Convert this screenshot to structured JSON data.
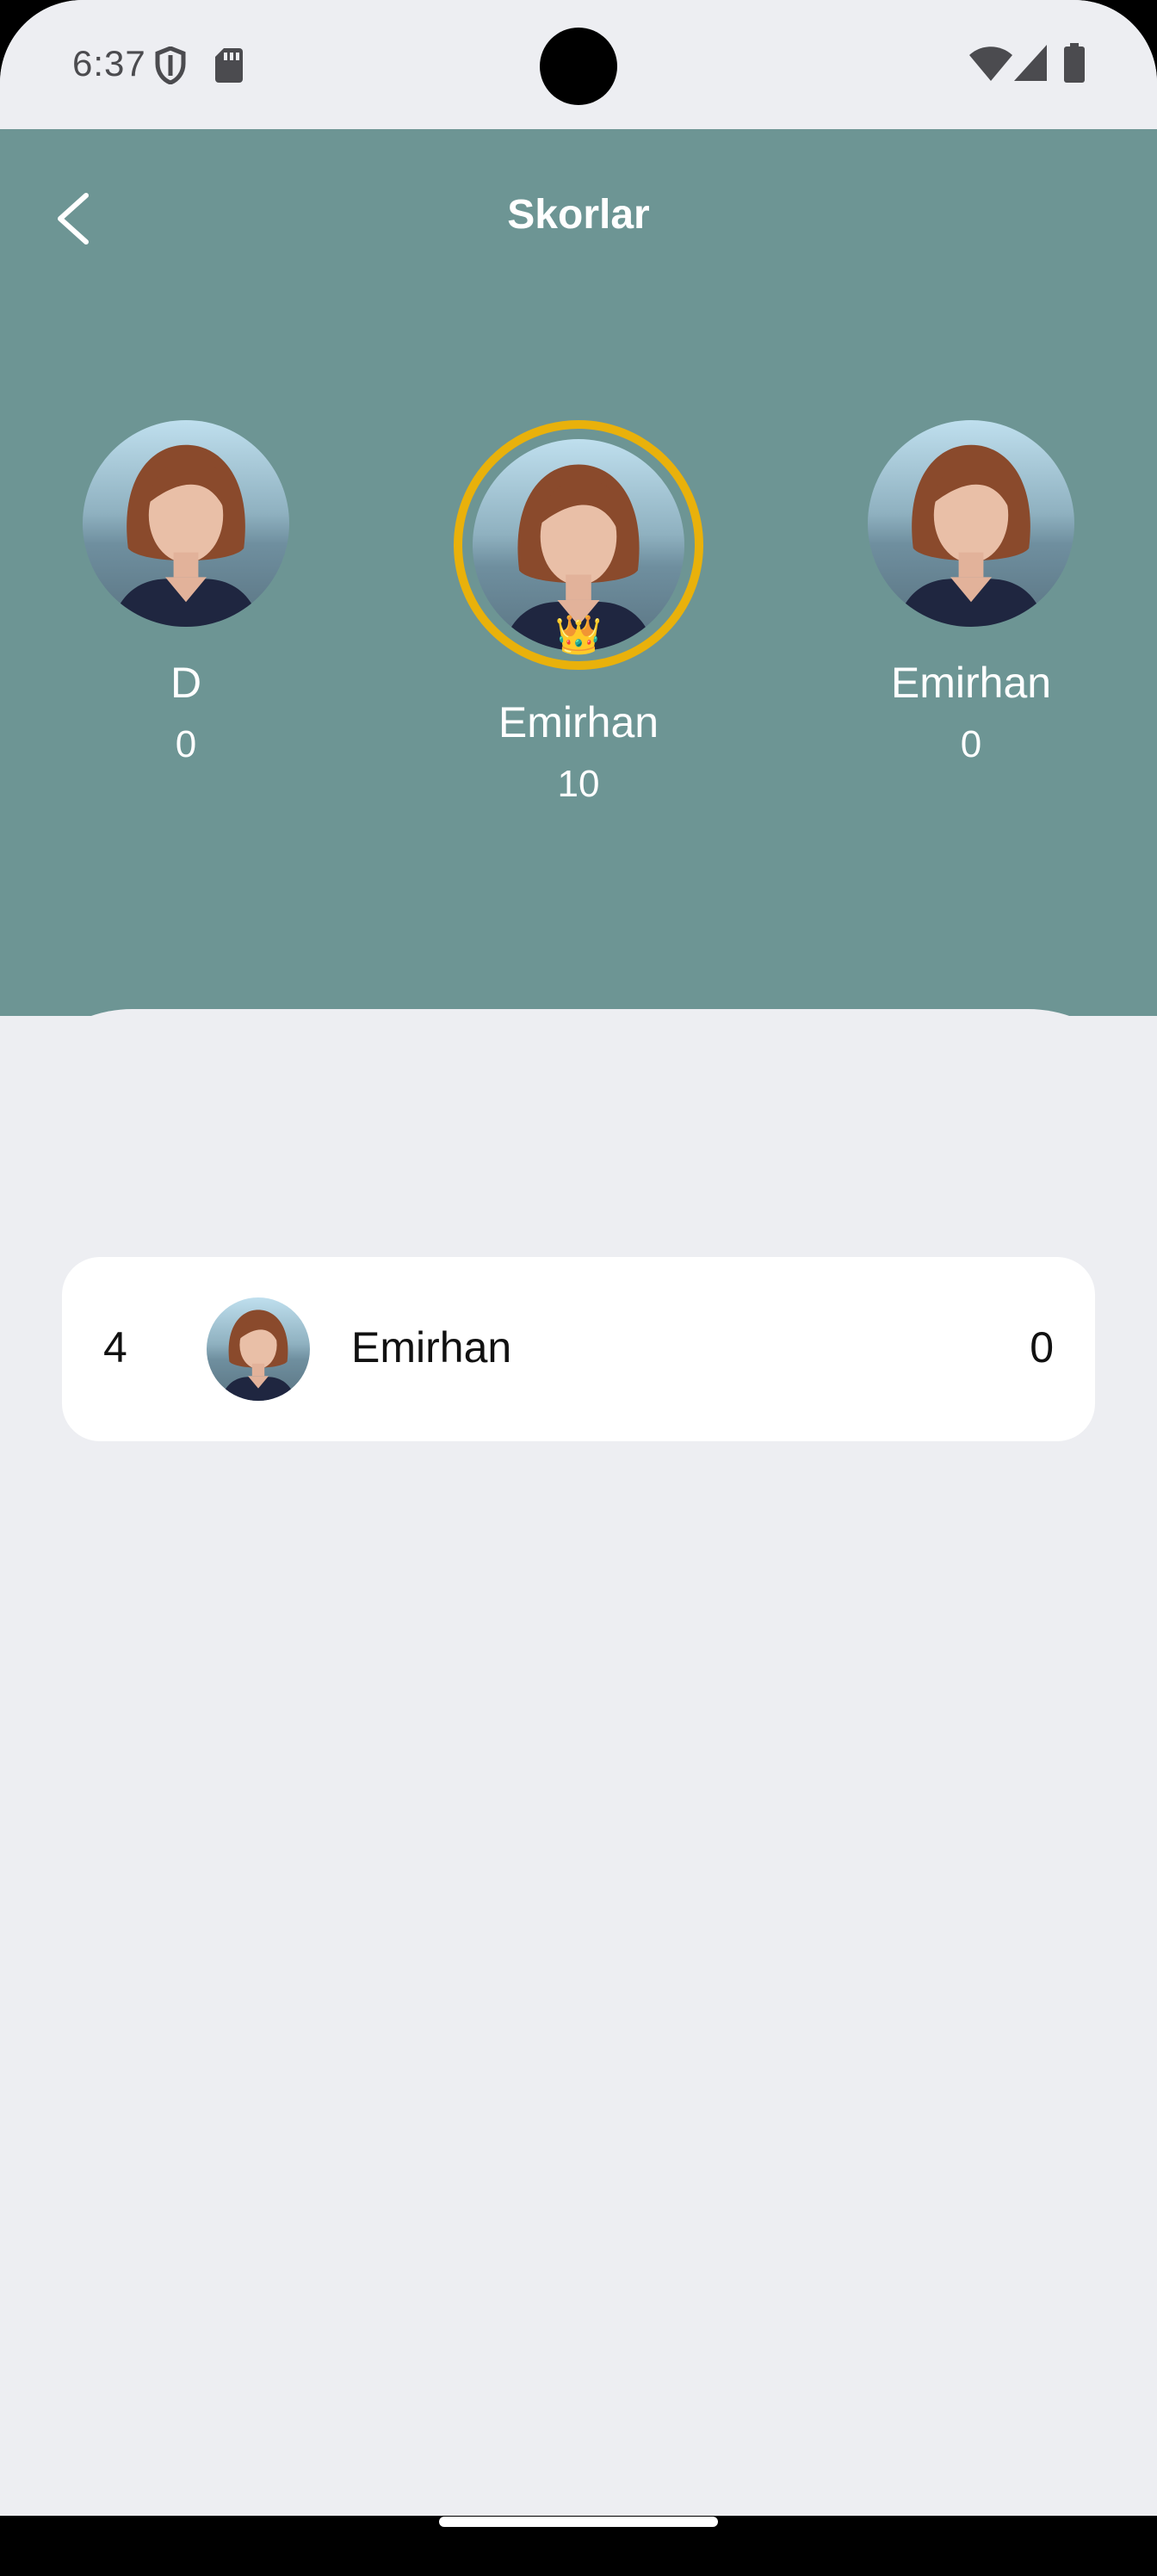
{
  "status_bar": {
    "time": "6:37",
    "icons": [
      "shield-icon",
      "sd-card-icon",
      "wifi-icon",
      "signal-icon",
      "battery-icon"
    ]
  },
  "header": {
    "title": "Skorlar",
    "back_icon": "chevron-left-icon",
    "background_color": "#6d9594"
  },
  "podium": {
    "left": {
      "name": "D",
      "score": "0"
    },
    "center": {
      "name": "Emirhan",
      "score": "10",
      "badge": "👑",
      "ring_color": "#e9b10b"
    },
    "right": {
      "name": "Emirhan",
      "score": "0"
    }
  },
  "list": [
    {
      "rank": "4",
      "name": "Emirhan",
      "score": "0"
    }
  ]
}
